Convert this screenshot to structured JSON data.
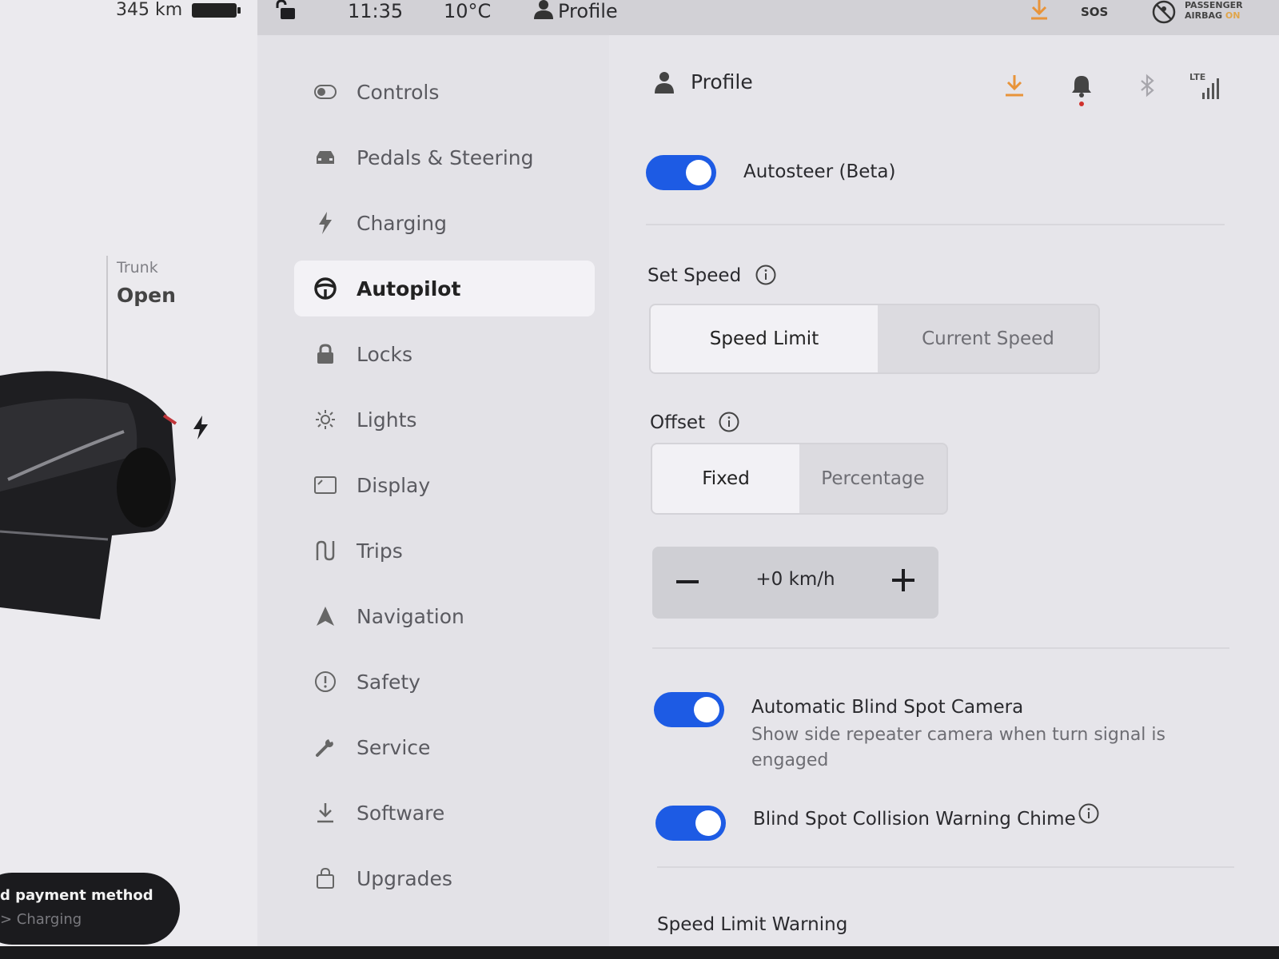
{
  "vehicle": {
    "range": "345 km",
    "trunk_label": "Trunk",
    "trunk_status": "Open",
    "payment_title": "d payment method",
    "payment_sub": "> Charging"
  },
  "status_bar": {
    "time": "11:35",
    "temperature": "10°C",
    "profile": "Profile",
    "sos": "SOS",
    "airbag_line1": "PASSENGER",
    "airbag_line2": "AIRBAG",
    "airbag_state": "ON"
  },
  "menu": {
    "items": [
      {
        "label": "Controls",
        "icon": "toggle-icon"
      },
      {
        "label": "Pedals & Steering",
        "icon": "car-icon"
      },
      {
        "label": "Charging",
        "icon": "bolt-icon"
      },
      {
        "label": "Autopilot",
        "icon": "steering-wheel-icon",
        "active": true
      },
      {
        "label": "Locks",
        "icon": "lock-icon"
      },
      {
        "label": "Lights",
        "icon": "sun-icon"
      },
      {
        "label": "Display",
        "icon": "display-icon"
      },
      {
        "label": "Trips",
        "icon": "trips-icon"
      },
      {
        "label": "Navigation",
        "icon": "navigation-icon"
      },
      {
        "label": "Safety",
        "icon": "alert-icon"
      },
      {
        "label": "Service",
        "icon": "wrench-icon"
      },
      {
        "label": "Software",
        "icon": "download-icon"
      },
      {
        "label": "Upgrades",
        "icon": "shopping-bag-icon"
      }
    ]
  },
  "header": {
    "profile": "Profile",
    "lte": "LTE"
  },
  "settings": {
    "autosteer_label": "Autosteer (Beta)",
    "autosteer_on": true,
    "set_speed_label": "Set Speed",
    "set_speed_options": [
      "Speed Limit",
      "Current Speed"
    ],
    "set_speed_selected": "Speed Limit",
    "offset_label": "Offset",
    "offset_options": [
      "Fixed",
      "Percentage"
    ],
    "offset_selected": "Fixed",
    "offset_value": "+0 km/h",
    "blind_spot_camera_label": "Automatic Blind Spot Camera",
    "blind_spot_camera_desc": "Show side repeater camera when turn signal is engaged",
    "blind_spot_camera_on": true,
    "blind_spot_chime_label": "Blind Spot Collision Warning Chime",
    "blind_spot_chime_on": true,
    "speed_limit_warning_label": "Speed Limit Warning"
  },
  "colors": {
    "accent": "#1d5be4",
    "download": "#e8943a",
    "notification_dot": "#d0312d"
  }
}
